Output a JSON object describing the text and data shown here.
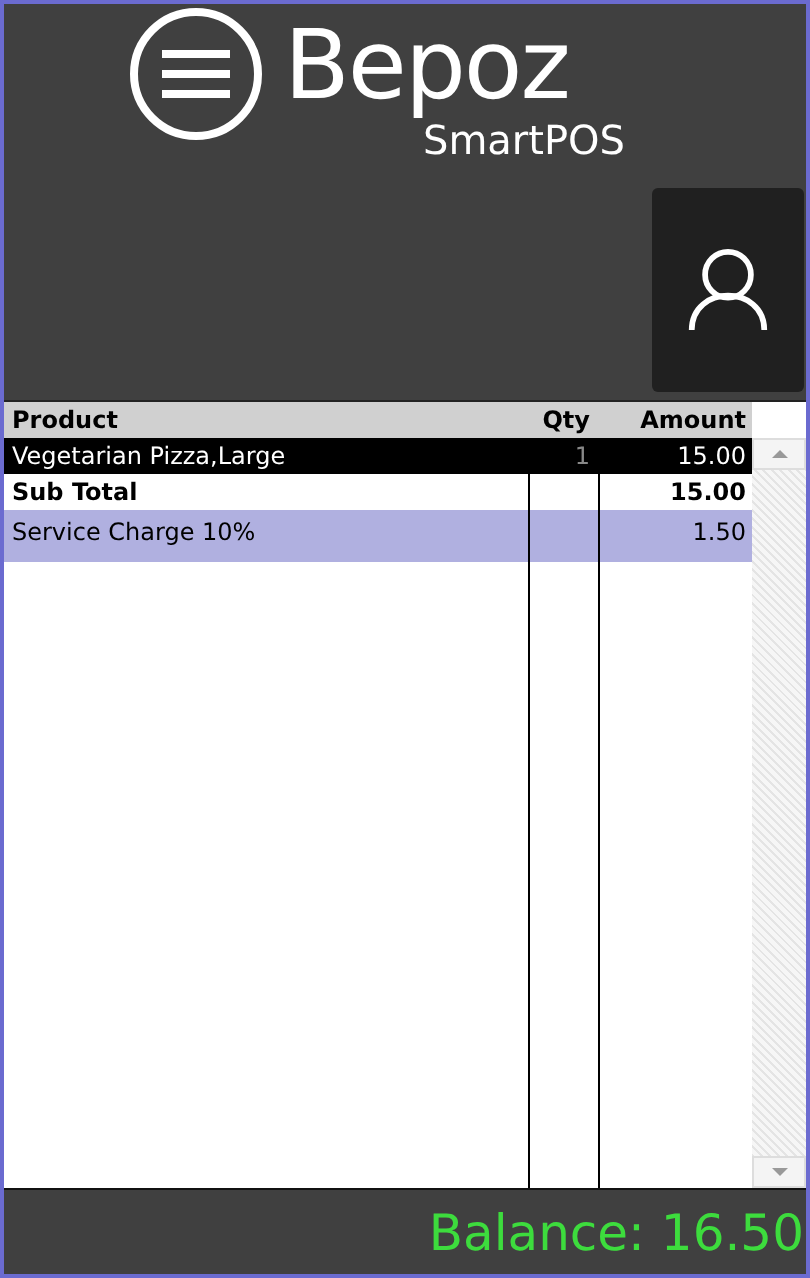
{
  "brand": {
    "name": "Bepoz",
    "subtitle": "SmartPOS"
  },
  "table": {
    "columns": [
      "Product",
      "Qty",
      "Amount"
    ],
    "rows": [
      {
        "kind": "item",
        "selected": true,
        "product": "Vegetarian Pizza,Large",
        "qty": "1",
        "amount": "15.00"
      },
      {
        "kind": "subtotal",
        "selected": false,
        "product": "Sub Total",
        "amount": "15.00"
      },
      {
        "kind": "charge",
        "selected": false,
        "product": "Service Charge 10%",
        "amount": "1.50"
      }
    ]
  },
  "balance": "Balance: 16.50"
}
